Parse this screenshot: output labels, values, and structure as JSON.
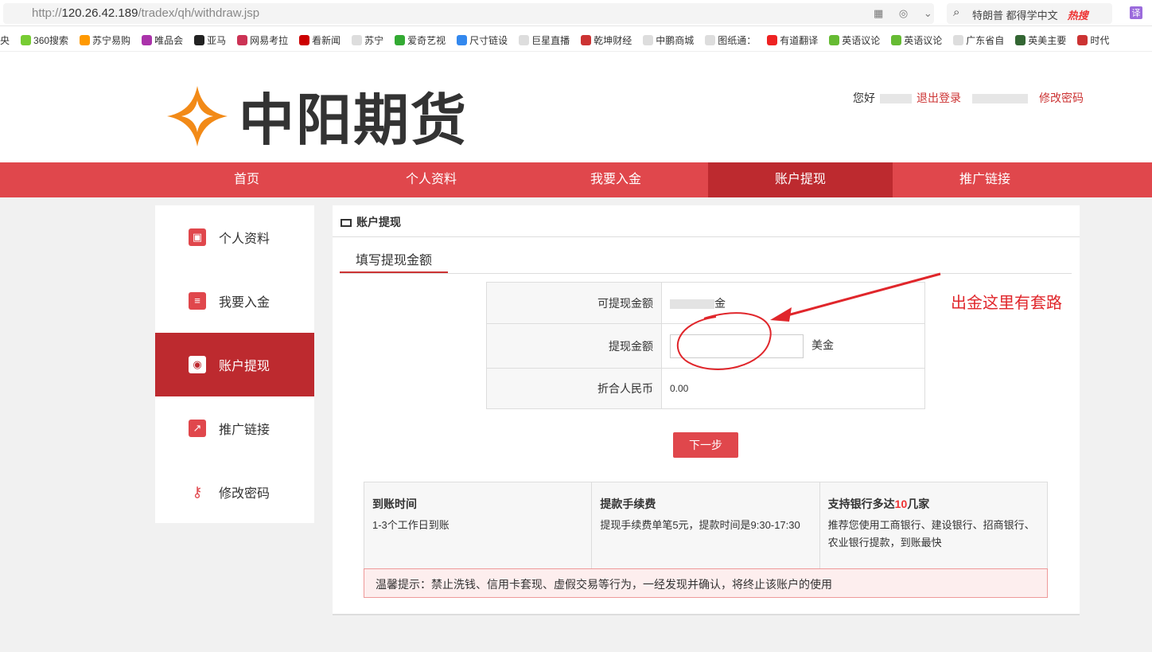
{
  "browser": {
    "url_prefix": "http://",
    "url_host": "120.26.42.189",
    "url_path": "/tradex/qh/withdraw.jsp",
    "search_text": "特朗普 都得学中文",
    "hot_label": "热搜",
    "translate_label": "译",
    "bookmarks": [
      "央",
      "360搜索",
      "苏宁易购",
      "唯品会",
      "亚马",
      "网易考拉",
      "看新闻",
      "苏宁",
      "爱奇艺视",
      "尺寸链设",
      "巨星直播",
      "乾坤财经",
      "中鹏商城",
      "图纸通：",
      "有道翻译",
      "英语议论",
      "英语议论",
      "广东省自",
      "英美主要",
      "时代"
    ]
  },
  "header": {
    "logo_text": "中阳期货",
    "greeting": "您好",
    "logout": "退出登录",
    "change_password": "修改密码"
  },
  "nav": [
    "首页",
    "个人资料",
    "我要入金",
    "账户提现",
    "推广链接"
  ],
  "sidebar": [
    {
      "label": "个人资料",
      "icon": "contact-icon"
    },
    {
      "label": "我要入金",
      "icon": "coins-icon"
    },
    {
      "label": "账户提现",
      "icon": "money-icon"
    },
    {
      "label": "推广链接",
      "icon": "share-icon"
    },
    {
      "label": "修改密码",
      "icon": "key-icon"
    }
  ],
  "main": {
    "title": "账户提现",
    "tab": "填写提现金额",
    "form": {
      "available_label": "可提现金额",
      "available_suffix": "金",
      "amount_label": "提现金额",
      "amount_value": "",
      "amount_unit": "美金",
      "rmb_label": "折合人民币",
      "rmb_value": "0.00"
    },
    "next_button": "下一步",
    "info": [
      {
        "title": "到账时间",
        "text": "1-3个工作日到账"
      },
      {
        "title": "提款手续费",
        "text": "提现手续费单笔5元，提款时间是9:30-17:30"
      },
      {
        "title_pre": "支持银行多达",
        "title_num": "10",
        "title_post": "几家",
        "text": "推荐您使用工商银行、建设银行、招商银行、农业银行提款，到账最快"
      }
    ],
    "warning": "温馨提示：禁止洗钱、信用卡套现、虚假交易等行为，一经发现并确认，将终止该账户的使用"
  },
  "annotation": {
    "text": "出金这里有套路",
    "color": "#e0262b"
  }
}
